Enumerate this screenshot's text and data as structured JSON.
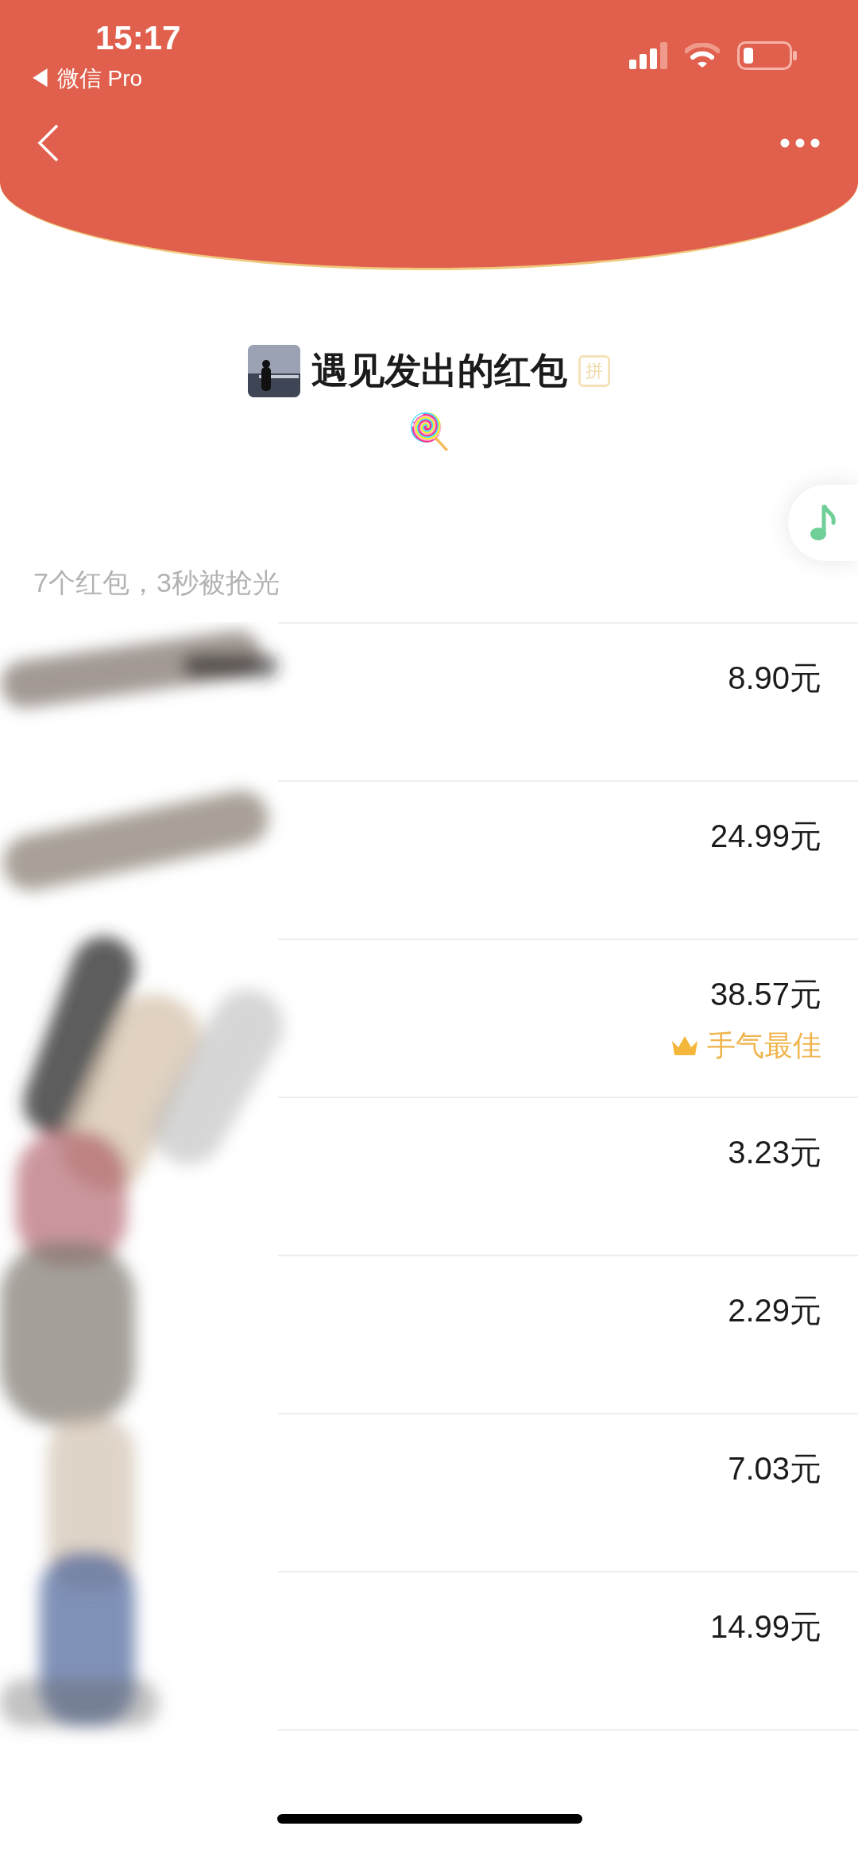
{
  "status_bar": {
    "time": "15:17",
    "back_app": "◀ 微信 Pro"
  },
  "header": {
    "title": "遇见发出的红包",
    "tag": "拼",
    "emoji": "🍭"
  },
  "summary": "7个红包，3秒被抢光",
  "rows": [
    {
      "amount": "8.90元",
      "best": false
    },
    {
      "amount": "24.99元",
      "best": false
    },
    {
      "amount": "38.57元",
      "best": true,
      "best_label": "手气最佳"
    },
    {
      "amount": "3.23元",
      "best": false
    },
    {
      "amount": "2.29元",
      "best": false
    },
    {
      "amount": "7.03元",
      "best": false
    },
    {
      "amount": "14.99元",
      "best": false
    }
  ]
}
